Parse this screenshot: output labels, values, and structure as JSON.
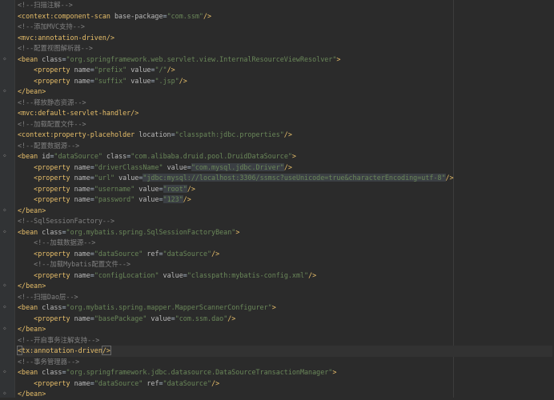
{
  "editor": {
    "lines": [
      {
        "tokens": [
          {
            "t": "<!--扫描注解-->",
            "c": "comment"
          }
        ]
      },
      {
        "tokens": [
          {
            "t": "<context:component-scan ",
            "c": "tag"
          },
          {
            "t": "base-package",
            "c": "attr"
          },
          {
            "t": "=",
            "c": "txt"
          },
          {
            "t": "\"com.ssm\"",
            "c": "str"
          },
          {
            "t": "/>",
            "c": "tag"
          }
        ]
      },
      {
        "tokens": [
          {
            "t": "<!--添加MVC支持-->",
            "c": "comment"
          }
        ]
      },
      {
        "tokens": [
          {
            "t": "<mvc:annotation-driven/>",
            "c": "tag"
          }
        ]
      },
      {
        "tokens": [
          {
            "t": "<!--配置视图解析器-->",
            "c": "comment"
          }
        ]
      },
      {
        "fold": true,
        "tokens": [
          {
            "t": "<bean ",
            "c": "tag"
          },
          {
            "t": "class",
            "c": "attr"
          },
          {
            "t": "=",
            "c": "txt"
          },
          {
            "t": "\"org.springframework.web.servlet.view.InternalResourceViewResolver\"",
            "c": "str"
          },
          {
            "t": ">",
            "c": "tag"
          }
        ]
      },
      {
        "indent": 4,
        "tokens": [
          {
            "t": "<property ",
            "c": "tag"
          },
          {
            "t": "name",
            "c": "attr"
          },
          {
            "t": "=",
            "c": "txt"
          },
          {
            "t": "\"prefix\"",
            "c": "str"
          },
          {
            "t": " value",
            "c": "attr"
          },
          {
            "t": "=",
            "c": "txt"
          },
          {
            "t": "\"/\"",
            "c": "str"
          },
          {
            "t": "/>",
            "c": "tag"
          }
        ]
      },
      {
        "indent": 4,
        "tokens": [
          {
            "t": "<property ",
            "c": "tag"
          },
          {
            "t": "name",
            "c": "attr"
          },
          {
            "t": "=",
            "c": "txt"
          },
          {
            "t": "\"suffix\"",
            "c": "str"
          },
          {
            "t": " value",
            "c": "attr"
          },
          {
            "t": "=",
            "c": "txt"
          },
          {
            "t": "\".jsp\"",
            "c": "str"
          },
          {
            "t": "/>",
            "c": "tag"
          }
        ]
      },
      {
        "fold": true,
        "tokens": [
          {
            "t": "</bean>",
            "c": "tag"
          }
        ]
      },
      {
        "tokens": [
          {
            "t": "<!--释放静态资源-->",
            "c": "comment"
          }
        ]
      },
      {
        "tokens": [
          {
            "t": "<mvc:default-servlet-handler/>",
            "c": "tag"
          }
        ]
      },
      {
        "tokens": [
          {
            "t": "<!--加载配置文件-->",
            "c": "comment"
          }
        ]
      },
      {
        "tokens": [
          {
            "t": "<context:property-placeholder ",
            "c": "tag"
          },
          {
            "t": "location",
            "c": "attr"
          },
          {
            "t": "=",
            "c": "txt"
          },
          {
            "t": "\"classpath:jdbc.properties\"",
            "c": "str"
          },
          {
            "t": "/>",
            "c": "tag"
          }
        ]
      },
      {
        "tokens": [
          {
            "t": "<!--配置数据源-->",
            "c": "comment"
          }
        ]
      },
      {
        "fold": true,
        "tokens": [
          {
            "t": "<bean ",
            "c": "tag"
          },
          {
            "t": "id",
            "c": "attr"
          },
          {
            "t": "=",
            "c": "txt"
          },
          {
            "t": "\"dataSource\"",
            "c": "str"
          },
          {
            "t": " class",
            "c": "attr"
          },
          {
            "t": "=",
            "c": "txt"
          },
          {
            "t": "\"com.alibaba.druid.pool.DruidDataSource\"",
            "c": "str"
          },
          {
            "t": ">",
            "c": "tag"
          }
        ]
      },
      {
        "indent": 4,
        "tokens": [
          {
            "t": "<property ",
            "c": "tag"
          },
          {
            "t": "name",
            "c": "attr"
          },
          {
            "t": "=",
            "c": "txt"
          },
          {
            "t": "\"driverClassName\"",
            "c": "str"
          },
          {
            "t": " value",
            "c": "attr"
          },
          {
            "t": "=",
            "c": "txt"
          },
          {
            "t": "\"com.mysql.jdbc.Driver\"",
            "c": "str",
            "hl": true
          },
          {
            "t": "/>",
            "c": "tag"
          }
        ]
      },
      {
        "indent": 4,
        "tokens": [
          {
            "t": "<property ",
            "c": "tag"
          },
          {
            "t": "name",
            "c": "attr"
          },
          {
            "t": "=",
            "c": "txt"
          },
          {
            "t": "\"url\"",
            "c": "str"
          },
          {
            "t": " value",
            "c": "attr"
          },
          {
            "t": "=",
            "c": "txt"
          },
          {
            "t": "\"jdbc:mysql://localhost:3306/ssmsc?useUnicode=true&characterEncoding=utf-8\"",
            "c": "str",
            "hl": true
          },
          {
            "t": "/>",
            "c": "tag"
          }
        ]
      },
      {
        "indent": 4,
        "tokens": [
          {
            "t": "<property ",
            "c": "tag"
          },
          {
            "t": "name",
            "c": "attr"
          },
          {
            "t": "=",
            "c": "txt"
          },
          {
            "t": "\"username\"",
            "c": "str"
          },
          {
            "t": " value",
            "c": "attr"
          },
          {
            "t": "=",
            "c": "txt"
          },
          {
            "t": "\"root\"",
            "c": "str",
            "hl": true
          },
          {
            "t": "/>",
            "c": "tag"
          }
        ]
      },
      {
        "indent": 4,
        "tokens": [
          {
            "t": "<property ",
            "c": "tag"
          },
          {
            "t": "name",
            "c": "attr"
          },
          {
            "t": "=",
            "c": "txt"
          },
          {
            "t": "\"password\"",
            "c": "str"
          },
          {
            "t": " value",
            "c": "attr"
          },
          {
            "t": "=",
            "c": "txt"
          },
          {
            "t": "\"123\"",
            "c": "str",
            "hl": true
          },
          {
            "t": "/>",
            "c": "tag"
          }
        ]
      },
      {
        "fold": true,
        "tokens": [
          {
            "t": "</bean>",
            "c": "tag"
          }
        ]
      },
      {
        "tokens": [
          {
            "t": "<!--SqlSessionFactory-->",
            "c": "comment"
          }
        ]
      },
      {
        "fold": true,
        "tokens": [
          {
            "t": "<bean ",
            "c": "tag"
          },
          {
            "t": "class",
            "c": "attr"
          },
          {
            "t": "=",
            "c": "txt"
          },
          {
            "t": "\"org.mybatis.spring.SqlSessionFactoryBean\"",
            "c": "str"
          },
          {
            "t": ">",
            "c": "tag"
          }
        ]
      },
      {
        "indent": 4,
        "tokens": [
          {
            "t": "<!--加载数据源-->",
            "c": "comment"
          }
        ]
      },
      {
        "indent": 4,
        "tokens": [
          {
            "t": "<property ",
            "c": "tag"
          },
          {
            "t": "name",
            "c": "attr"
          },
          {
            "t": "=",
            "c": "txt"
          },
          {
            "t": "\"dataSource\"",
            "c": "str"
          },
          {
            "t": " ref",
            "c": "attr"
          },
          {
            "t": "=",
            "c": "txt"
          },
          {
            "t": "\"dataSource\"",
            "c": "str"
          },
          {
            "t": "/>",
            "c": "tag"
          }
        ]
      },
      {
        "indent": 4,
        "tokens": [
          {
            "t": "<!--加载Mybatis配置文件-->",
            "c": "comment"
          }
        ]
      },
      {
        "indent": 4,
        "tokens": [
          {
            "t": "<property ",
            "c": "tag"
          },
          {
            "t": "name",
            "c": "attr"
          },
          {
            "t": "=",
            "c": "txt"
          },
          {
            "t": "\"configLocation\"",
            "c": "str"
          },
          {
            "t": " value",
            "c": "attr"
          },
          {
            "t": "=",
            "c": "txt"
          },
          {
            "t": "\"classpath:mybatis-config.xml\"",
            "c": "str"
          },
          {
            "t": "/>",
            "c": "tag"
          }
        ]
      },
      {
        "fold": true,
        "tokens": [
          {
            "t": "</bean>",
            "c": "tag"
          }
        ]
      },
      {
        "tokens": [
          {
            "t": "<!--扫描Dao层-->",
            "c": "comment"
          }
        ]
      },
      {
        "fold": true,
        "tokens": [
          {
            "t": "<bean ",
            "c": "tag"
          },
          {
            "t": "class",
            "c": "attr"
          },
          {
            "t": "=",
            "c": "txt"
          },
          {
            "t": "\"org.mybatis.spring.mapper.MapperScannerConfigurer\"",
            "c": "str"
          },
          {
            "t": ">",
            "c": "tag"
          }
        ]
      },
      {
        "indent": 4,
        "tokens": [
          {
            "t": "<property ",
            "c": "tag"
          },
          {
            "t": "name",
            "c": "attr"
          },
          {
            "t": "=",
            "c": "txt"
          },
          {
            "t": "\"basePackage\"",
            "c": "str"
          },
          {
            "t": " value",
            "c": "attr"
          },
          {
            "t": "=",
            "c": "txt"
          },
          {
            "t": "\"com.ssm.dao\"",
            "c": "str"
          },
          {
            "t": "/>",
            "c": "tag"
          }
        ]
      },
      {
        "fold": true,
        "tokens": [
          {
            "t": "</bean>",
            "c": "tag"
          }
        ]
      },
      {
        "tokens": [
          {
            "t": "<!--开启事务注解支持-->",
            "c": "comment"
          }
        ]
      },
      {
        "current": true,
        "tokens": [
          {
            "t": "<",
            "c": "tag",
            "box": true
          },
          {
            "t": "tx:annotation-driven",
            "c": "tag"
          },
          {
            "t": "/>",
            "c": "tag",
            "box": true,
            "caret": true
          }
        ]
      },
      {
        "tokens": [
          {
            "t": "<!--事务管理器-->",
            "c": "comment"
          }
        ]
      },
      {
        "fold": true,
        "tokens": [
          {
            "t": "<bean ",
            "c": "tag"
          },
          {
            "t": "class",
            "c": "attr"
          },
          {
            "t": "=",
            "c": "txt"
          },
          {
            "t": "\"org.springframework.jdbc.datasource.DataSourceTransactionManager\"",
            "c": "str"
          },
          {
            "t": ">",
            "c": "tag"
          }
        ]
      },
      {
        "indent": 4,
        "tokens": [
          {
            "t": "<property ",
            "c": "tag"
          },
          {
            "t": "name",
            "c": "attr"
          },
          {
            "t": "=",
            "c": "txt"
          },
          {
            "t": "\"dataSource\"",
            "c": "str"
          },
          {
            "t": " ref",
            "c": "attr"
          },
          {
            "t": "=",
            "c": "txt"
          },
          {
            "t": "\"dataSource\"",
            "c": "str"
          },
          {
            "t": "/>",
            "c": "tag"
          }
        ]
      },
      {
        "fold": true,
        "tokens": [
          {
            "t": "</bean>",
            "c": "tag"
          }
        ]
      }
    ]
  }
}
